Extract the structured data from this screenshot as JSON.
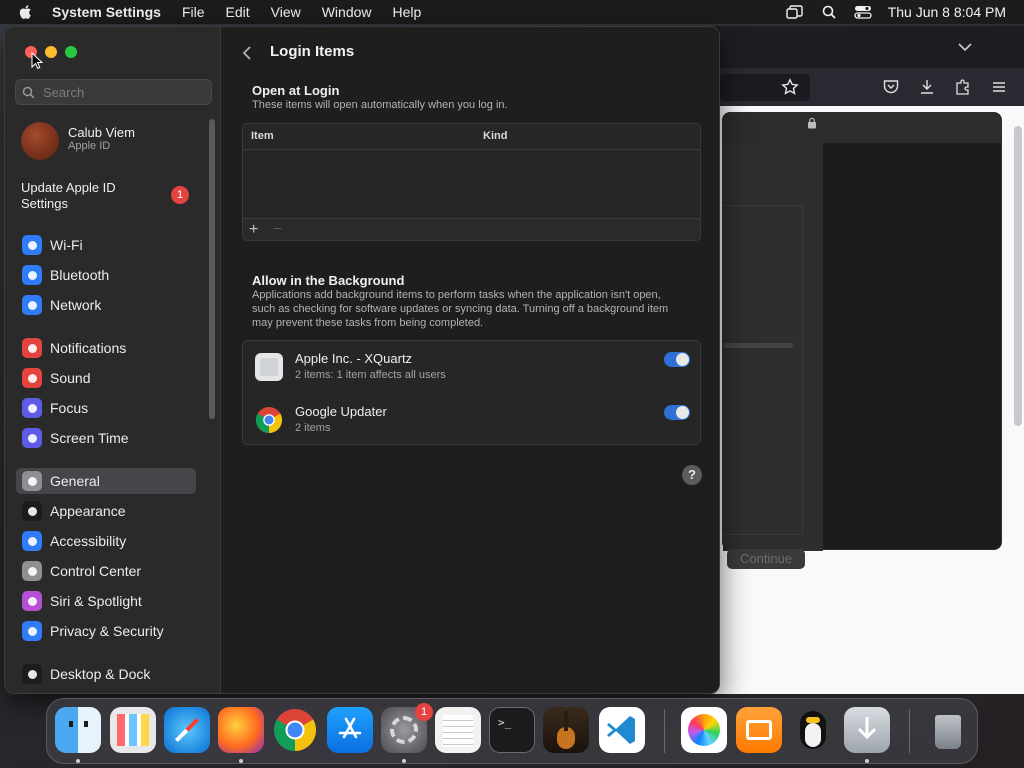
{
  "menubar": {
    "app_name": "System Settings",
    "menus": [
      "File",
      "Edit",
      "View",
      "Window",
      "Help"
    ],
    "clock": "Thu Jun 8  8:04 PM"
  },
  "sidebar": {
    "search_placeholder": "Search",
    "account": {
      "name": "Calub Viem",
      "subtitle": "Apple ID"
    },
    "update": {
      "label": "Update Apple ID Settings",
      "badge": "1"
    },
    "items": [
      {
        "label": "Wi-Fi",
        "icon": "wifi-icon",
        "color": "#2f7cf6"
      },
      {
        "label": "Bluetooth",
        "icon": "bluetooth-icon",
        "color": "#2f7cf6"
      },
      {
        "label": "Network",
        "icon": "globe-icon",
        "color": "#2f7cf6"
      },
      {
        "label": "Notifications",
        "icon": "bell-icon",
        "color": "#e5433f"
      },
      {
        "label": "Sound",
        "icon": "speaker-icon",
        "color": "#e5433f"
      },
      {
        "label": "Focus",
        "icon": "moon-icon",
        "color": "#5d5ce6"
      },
      {
        "label": "Screen Time",
        "icon": "hourglass-icon",
        "color": "#5d5ce6"
      },
      {
        "label": "General",
        "icon": "gear-icon",
        "color": "#8e8e93",
        "selected": true
      },
      {
        "label": "Appearance",
        "icon": "appearance-icon",
        "color": "#1c1c1e"
      },
      {
        "label": "Accessibility",
        "icon": "accessibility-icon",
        "color": "#2f7cf6"
      },
      {
        "label": "Control Center",
        "icon": "switches-icon",
        "color": "#8e8e93"
      },
      {
        "label": "Siri & Spotlight",
        "icon": "siri-icon",
        "color": "#b44fd6"
      },
      {
        "label": "Privacy & Security",
        "icon": "hand-icon",
        "color": "#2f7cf6"
      },
      {
        "label": "Desktop & Dock",
        "icon": "dock-icon",
        "color": "#1c1c1e"
      }
    ]
  },
  "main": {
    "title": "Login Items",
    "open_at_login": {
      "title": "Open at Login",
      "desc": "These items will open automatically when you log in.",
      "columns": [
        "Item",
        "Kind"
      ],
      "add": "+",
      "remove": "−"
    },
    "background": {
      "title": "Allow in the Background",
      "desc": "Applications add background items to perform tasks when the application isn't open, such as checking for software updates or syncing data. Turning off a background item may prevent these tasks from being completed.",
      "items": [
        {
          "name": "Apple Inc. - XQuartz",
          "sub": "2 items: 1 item affects all users",
          "enabled": true
        },
        {
          "name": "Google Updater",
          "sub": "2 items",
          "enabled": true
        }
      ]
    },
    "help": "?"
  },
  "installer": {
    "button": "Continue"
  },
  "dock": {
    "apps": [
      "Finder",
      "Launchpad",
      "Safari",
      "Firefox",
      "Chrome",
      "App Store",
      "System Settings",
      "TextEdit",
      "Terminal",
      "GarageBand",
      "Visual Studio Code",
      "Photos",
      "Books",
      "Tux",
      "Downloads",
      "Trash"
    ],
    "settings_badge": "1"
  }
}
